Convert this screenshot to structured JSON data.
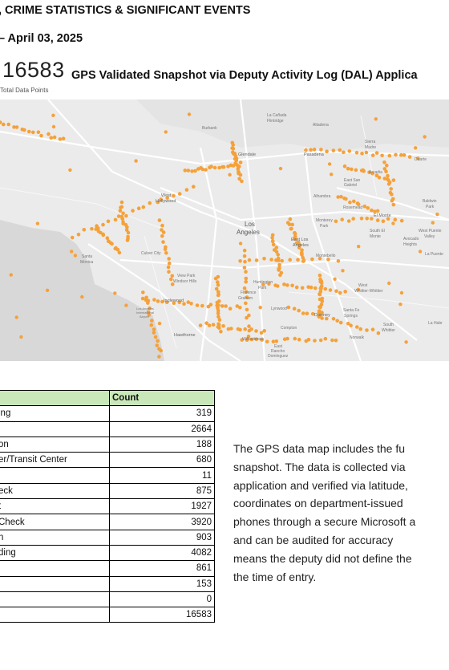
{
  "header": {
    "line1": ", CRIME STATISTICS & SIGNIFICANT EVENTS",
    "line2": "– April 03, 2025"
  },
  "kpi": {
    "value": "16583",
    "label": "Total Data Points"
  },
  "map": {
    "title": "GPS Validated Snapshot via Deputy Activity Log (DAL) Applica",
    "labels": {
      "burbank": "Burbank",
      "la_canada": "La Cañada",
      "flintridge": "Flintridge",
      "altadena": "Altadena",
      "glendale": "Glendale",
      "pasadena": "Pasadena",
      "sierra": "Sierra",
      "madre": "Madre",
      "duarte": "Duarte",
      "arcadia": "Arcadia",
      "east_san": "East San",
      "gabriel": "Gabriel",
      "alhambra": "Alhambra",
      "rosemead": "Rosemead",
      "el_monte": "El Monte",
      "baldwin": "Baldwin",
      "park": "Park",
      "west": "West",
      "hollywood": "Hollywood",
      "los": "Los",
      "angeles": "Angeles",
      "monterey": "Monterey",
      "monterey_park": "Park",
      "south_el": "South El",
      "monte": "Monte",
      "west_puente": "West Puente",
      "valley": "Valley",
      "avocado": "Avocado",
      "heights": "Heights",
      "la_puente": "La Puente",
      "east_los": "East Los",
      "east_angeles": "Angeles",
      "montebello": "Montebello",
      "culver_city": "Culver City",
      "santa": "Santa",
      "monica": "Monica",
      "view_park": "View Park",
      "windsor_hills": "Windsor Hills",
      "inglewood": "Inglewood",
      "huntington": "Huntington",
      "huntington_park": "Park",
      "florence": "Florence",
      "graham": "Graham",
      "la_airport": "Los Angeles",
      "la_airport2": "International",
      "la_airport3": "Airport",
      "hawthorne": "Hawthorne",
      "whittier": "Whittier",
      "west_whittier": "West",
      "west_whittier2": "Whittier-Whittier",
      "downey": "Downey",
      "santa_fe": "Santa Fe",
      "springs": "Springs",
      "south_whittier": "South",
      "south_whittier2": "Whittier",
      "norwalk": "Norwalk",
      "la_habra": "La Habr",
      "willowbrook": "Willowbrook",
      "east": "East",
      "rancho": "Rancho",
      "dominguez": "Dominguez",
      "lynwood": "Lynwood",
      "compton": "Compton"
    }
  },
  "table": {
    "header_count": "Count",
    "rows": [
      {
        "label": "ing",
        "count": "319"
      },
      {
        "label": "",
        "count": "2664"
      },
      {
        "label": "on",
        "count": "188"
      },
      {
        "label": "er/Transit Center",
        "count": "680"
      },
      {
        "label": "",
        "count": "11"
      },
      {
        "label": "eck",
        "count": "875"
      },
      {
        "label": "t",
        "count": "1927"
      },
      {
        "label": "Check",
        "count": "3920"
      },
      {
        "label": "n",
        "count": "903"
      },
      {
        "label": "ding",
        "count": "4082"
      },
      {
        "label": "",
        "count": "861"
      },
      {
        "label": "",
        "count": "153"
      },
      {
        "label": "",
        "count": "0"
      },
      {
        "label": "",
        "count": "16583"
      }
    ]
  },
  "paragraph": {
    "lines": [
      "The GPS data map includes the fu",
      "snapshot. The data is collected via",
      "application and verified via latitude,",
      "coordinates on department-issued",
      "phones through a secure Microsoft a",
      "and can be audited for accuracy",
      "means the deputy did not define the",
      "the time of entry."
    ]
  },
  "colors": {
    "dot": "#f5a13a",
    "table_header": "#c9e8b9",
    "water": "#dcdcdc",
    "land": "#ebebeb"
  }
}
